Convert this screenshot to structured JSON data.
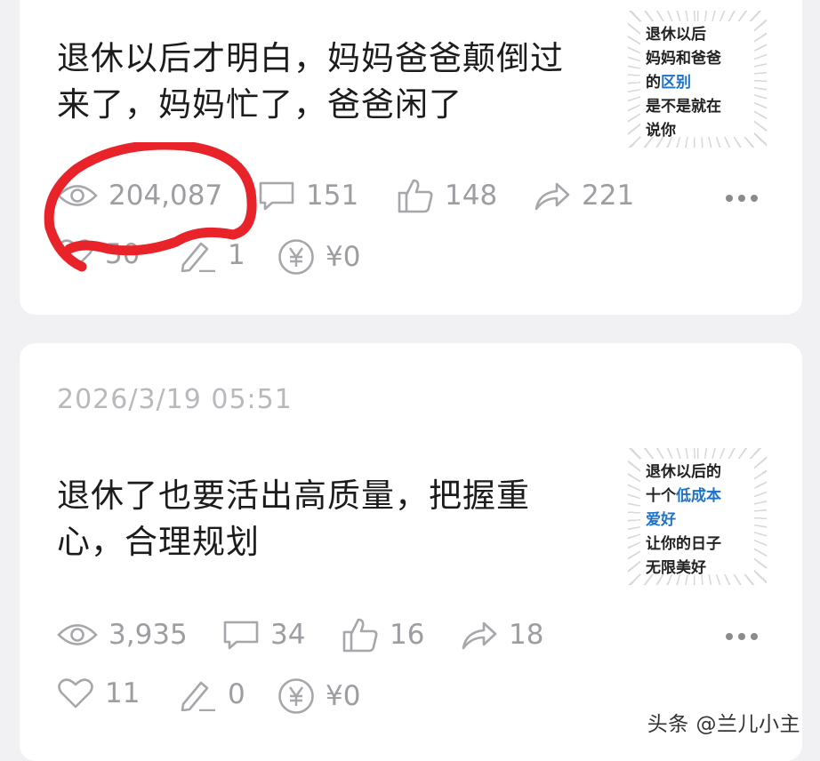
{
  "posts": [
    {
      "title": "退休以后才明白，妈妈爸爸颠倒过来了，妈妈忙了，爸爸闲了",
      "thumb_lines": [
        "退休以后",
        "妈妈和爸爸",
        "的",
        "区别",
        "是不是就在",
        "说你"
      ],
      "stats": {
        "views": "204,087",
        "comments": "151",
        "likes": "148",
        "shares": "221",
        "favorites": "50",
        "edits": "1",
        "earnings": "¥0"
      },
      "annotation_color": "#e8232a"
    },
    {
      "date": "2026/3/19 05:51",
      "title": "退休了也要活出高质量，把握重心，合理规划",
      "thumb_lines": [
        "退休以后的",
        "十个",
        "低成本",
        "爱好",
        "让你的日子",
        "无限美好"
      ],
      "stats": {
        "views": "3,935",
        "comments": "34",
        "likes": "16",
        "shares": "18",
        "favorites": "11",
        "edits": "0",
        "earnings": "¥0"
      }
    }
  ],
  "icons": [
    "eye-icon",
    "comment-icon",
    "thumbs-up-icon",
    "share-icon",
    "heart-icon",
    "pencil-icon",
    "yen-icon",
    "more-icon"
  ],
  "watermark": "头条 @兰儿小主"
}
